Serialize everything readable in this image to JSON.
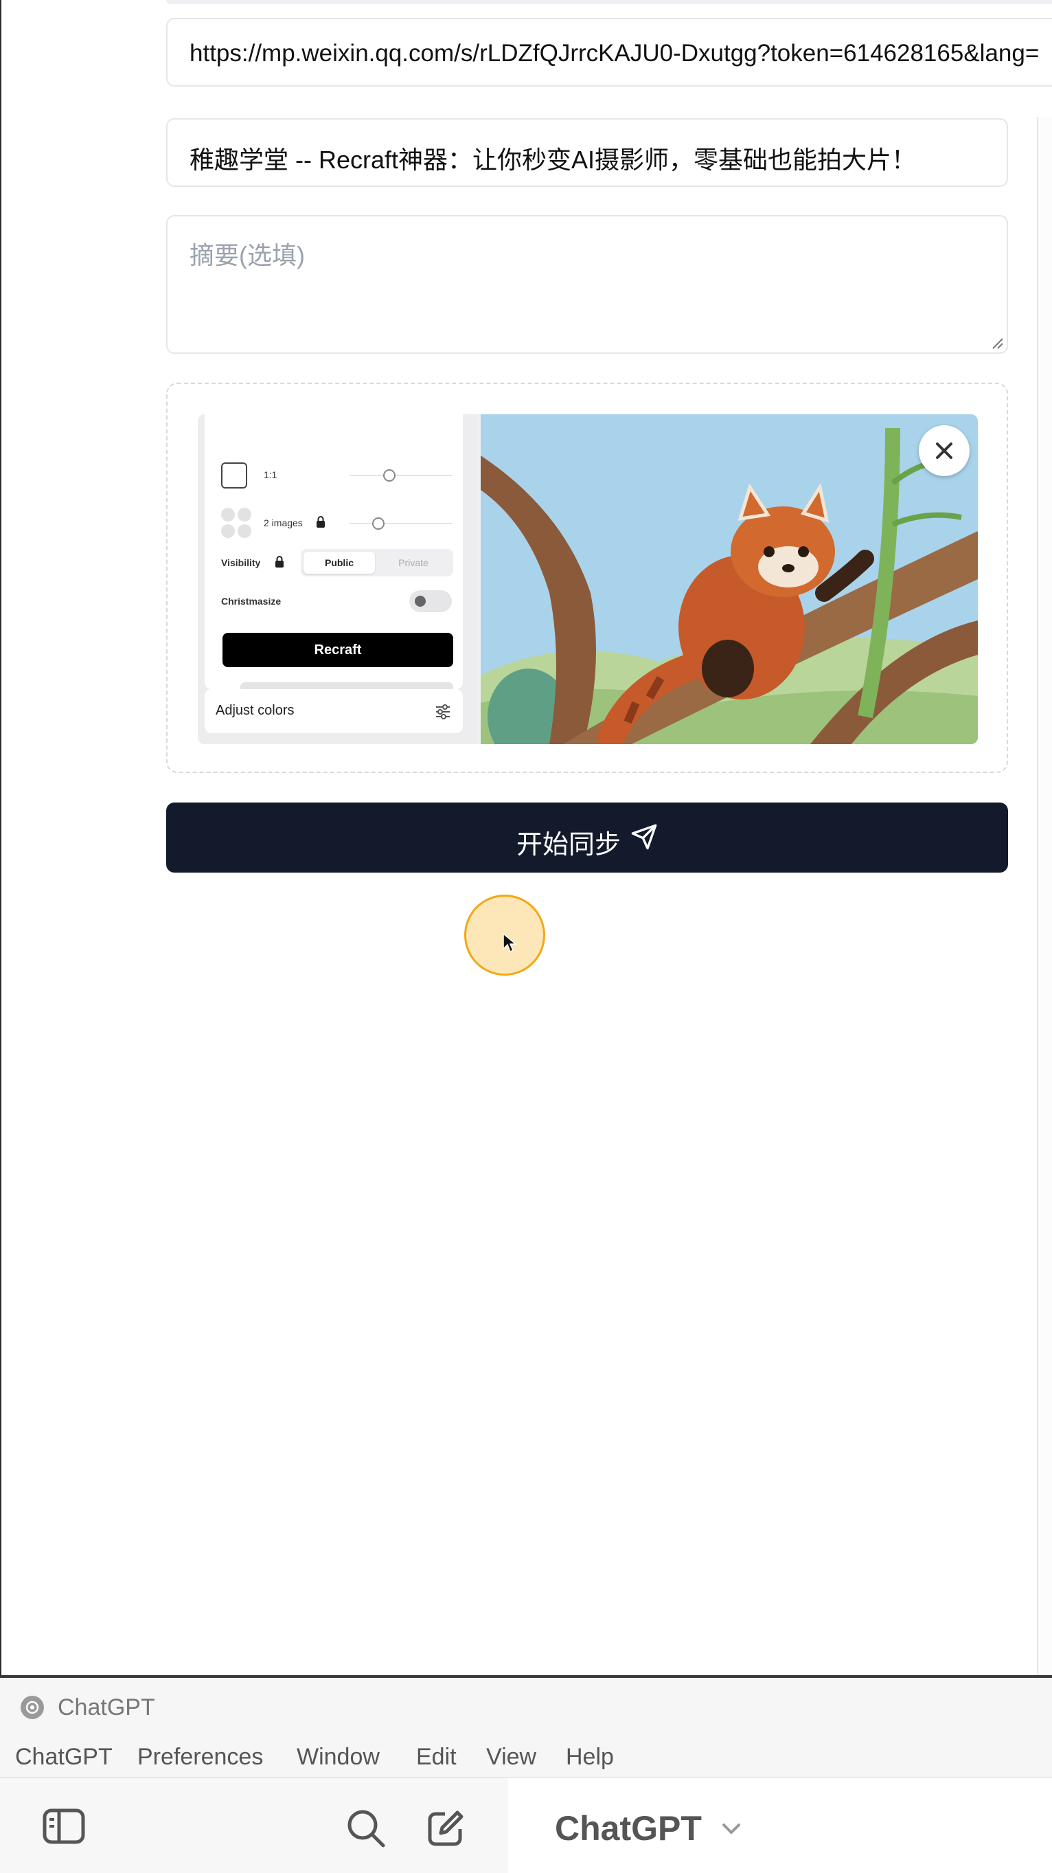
{
  "form": {
    "url_value": "https://mp.weixin.qq.com/s/rLDZfQJrrcKAJU0-Dxutgg?token=614628165&lang=",
    "title_value": "稚趣学堂 -- Recraft神器：让你秒变AI摄影师，零基础也能拍大片！",
    "summary_placeholder": "摘要(选填)",
    "submit_label": "开始同步"
  },
  "preview": {
    "ratio_label": "1:1",
    "images_label": "2 images",
    "visibility_label": "Visibility",
    "public_label": "Public",
    "private_label": "Private",
    "christmasize_label": "Christmasize",
    "recraft_button": "Recraft",
    "adjust_colors_label": "Adjust colors"
  },
  "chatgpt_window": {
    "title": "ChatGPT",
    "menu": [
      "ChatGPT",
      "Preferences",
      "Window",
      "Edit",
      "View",
      "Help"
    ],
    "model_label": "ChatGPT"
  },
  "colors": {
    "submit_bg": "#121a2b",
    "cursor_fill": "#fde6b7",
    "cursor_ring": "#f2a813"
  },
  "icons": [
    "close-icon",
    "send-icon",
    "sidebar-toggle-icon",
    "search-icon",
    "new-chat-icon",
    "chevron-down-icon",
    "sliders-icon",
    "lock-icon"
  ]
}
